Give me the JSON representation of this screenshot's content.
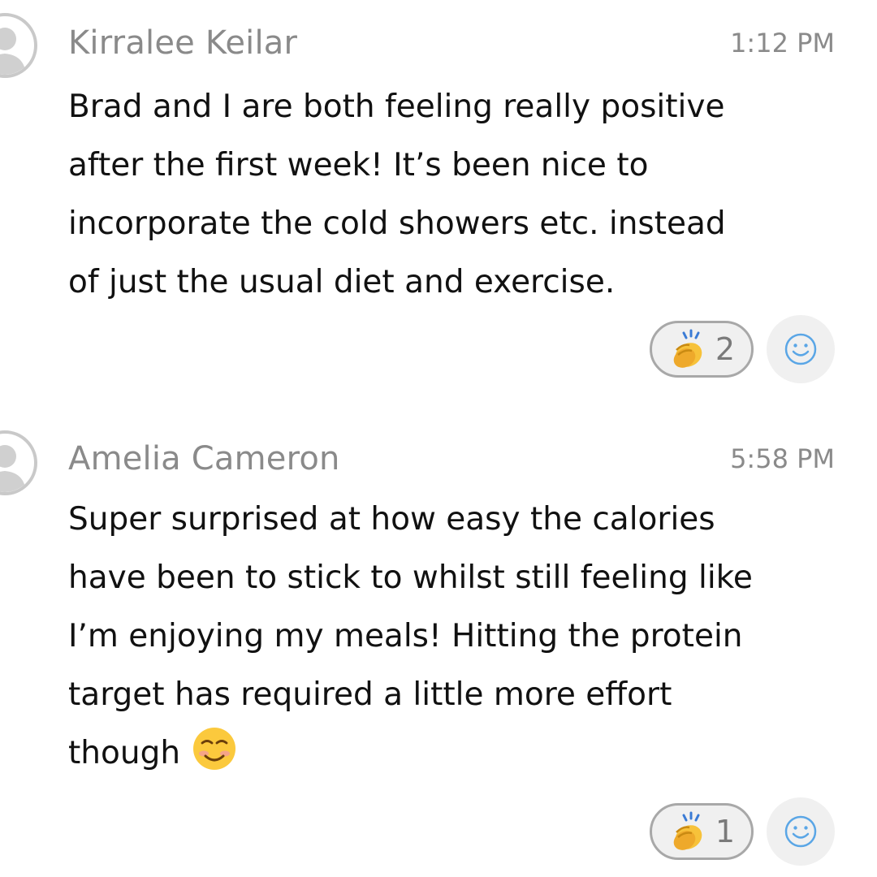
{
  "messages": [
    {
      "author": "Kirralee Keilar",
      "time": "1:12 PM",
      "lines": [
        "Brad and I are both feeling really positive",
        "after the first week! It’s been nice to",
        "incorporate the cold showers etc. instead",
        "of just the usual diet and exercise."
      ],
      "trailing_emoji": "",
      "reaction": {
        "icon": "clapping-hands-icon",
        "count": "2"
      },
      "add_reaction_icon": "smiley-icon"
    },
    {
      "author": "Amelia Cameron",
      "time": "5:58 PM",
      "lines": [
        "Super surprised at how easy the calories",
        "have been to stick to whilst still feeling like",
        "I’m enjoying my meals! Hitting the protein",
        "target has required a little more effort",
        "though"
      ],
      "trailing_emoji": "smiling-face-icon",
      "reaction": {
        "icon": "clapping-hands-icon",
        "count": "1"
      },
      "add_reaction_icon": "smiley-icon"
    }
  ],
  "colors": {
    "author_text": "#8a8a8a",
    "body_text": "#111111",
    "pill_border": "#a8a8a8",
    "pill_background": "#f0f0f0",
    "smiley_icon": "#5aa6e6"
  }
}
